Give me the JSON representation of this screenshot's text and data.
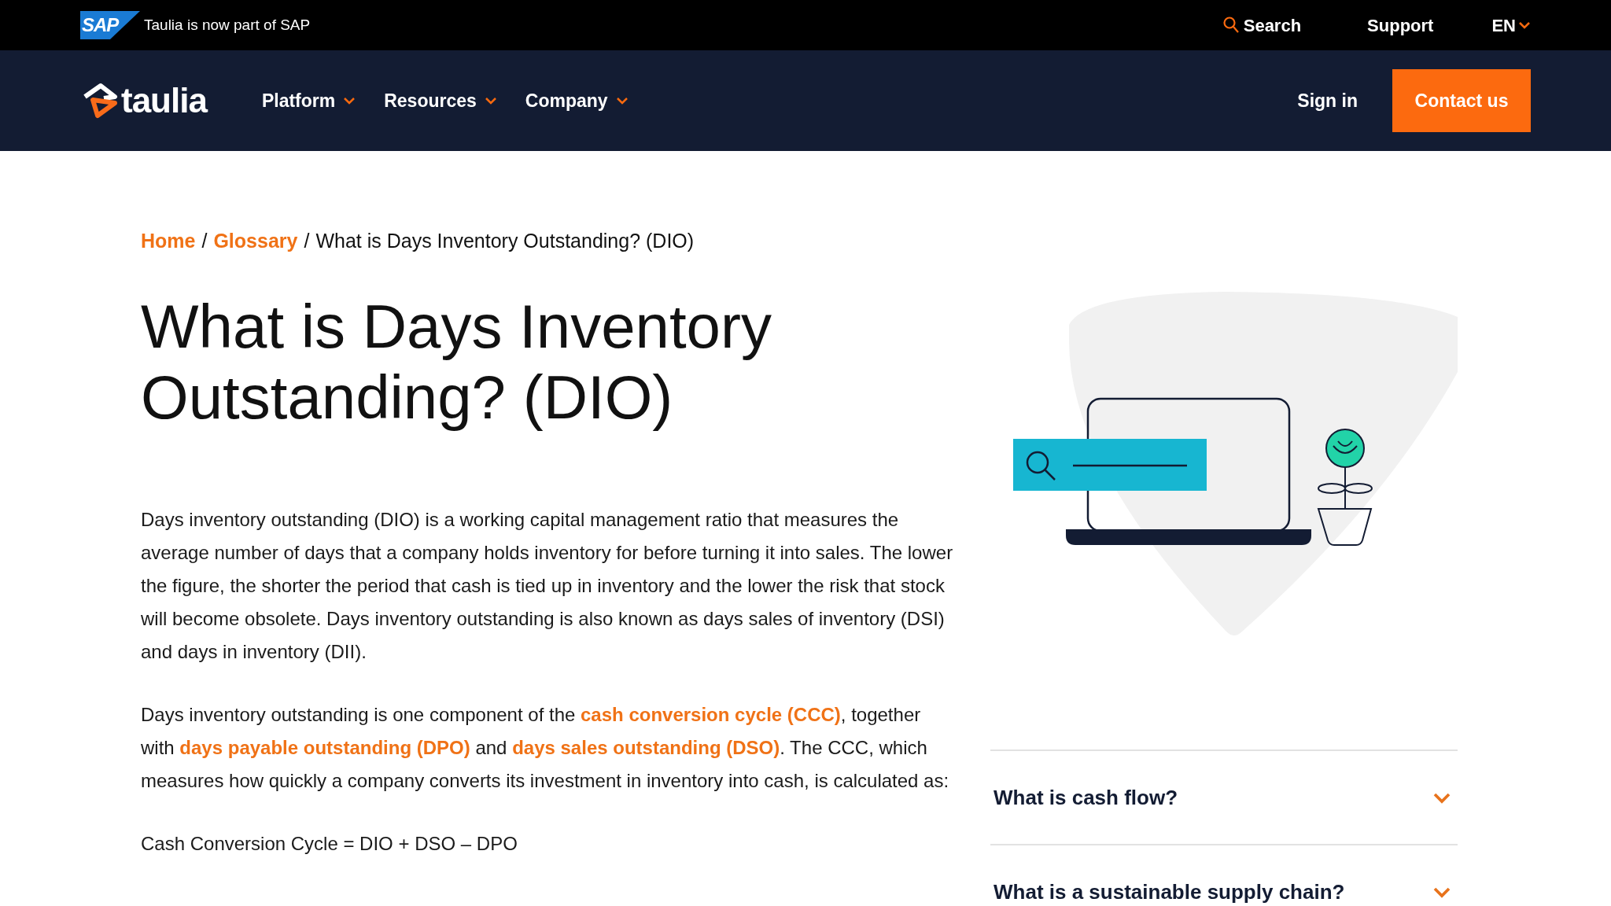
{
  "top_bar": {
    "logo": "SAP",
    "announcement": "Taulia is now part of SAP",
    "search": "Search",
    "support": "Support",
    "language": "EN"
  },
  "nav": {
    "items": [
      {
        "label": "Platform"
      },
      {
        "label": "Resources"
      },
      {
        "label": "Company"
      }
    ],
    "sign_in": "Sign in",
    "contact": "Contact us",
    "logo": "taulia"
  },
  "breadcrumb": [
    {
      "label": "Home",
      "kind": "link"
    },
    {
      "label": "/",
      "kind": "separator"
    },
    {
      "label": "Glossary",
      "kind": "link"
    },
    {
      "label": "/",
      "kind": "separator"
    },
    {
      "label": "What is Days Inventory Outstanding? (DIO)",
      "kind": "current"
    }
  ],
  "title": "What is Days Inventory Outstanding? (DIO)",
  "paragraphs": [
    [
      {
        "kind": "text",
        "text": "Days inventory outstanding (DIO) is a working capital management ratio that measures the average number of days that a company holds inventory for before turning it into sales. The lower the figure, the shorter the period that cash is tied up in inventory and the lower the risk that stock will become obsolete. Days inventory outstanding is also known as days sales of inventory (DSI) and days in inventory (DII)."
      }
    ],
    [
      {
        "kind": "text",
        "text": "Days inventory outstanding is one component of the "
      },
      {
        "kind": "link",
        "text": "cash conversion cycle (CCC)"
      },
      {
        "kind": "text",
        "text": ", together with "
      },
      {
        "kind": "link",
        "text": "days payable outstanding (DPO)"
      },
      {
        "kind": "text",
        "text": " and "
      },
      {
        "kind": "link",
        "text": "days sales outstanding (DSO)"
      },
      {
        "kind": "text",
        "text": ". The CCC, which measures how quickly a company converts its investment in inventory into cash, is calculated as:"
      }
    ],
    [
      {
        "kind": "text",
        "text": "Cash Conversion Cycle = DIO + DSO – DPO"
      }
    ]
  ],
  "related": [
    {
      "label": "What is cash flow?",
      "expanded": false
    },
    {
      "label": "What is a sustainable supply chain?",
      "expanded": false
    }
  ]
}
